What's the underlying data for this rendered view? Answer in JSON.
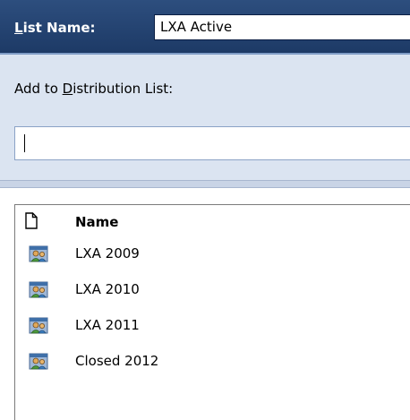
{
  "header": {
    "list_name_label_first": "L",
    "list_name_label_rest": "ist Name:",
    "list_name_value": "LXA Active"
  },
  "distribution": {
    "label_before": "Add to ",
    "label_underlined": "D",
    "label_after": "istribution List:",
    "input_value": ""
  },
  "list": {
    "name_column_header": "Name",
    "items": [
      {
        "label": "LXA 2009",
        "icon": "contact-group-icon"
      },
      {
        "label": "LXA 2010",
        "icon": "contact-group-icon"
      },
      {
        "label": "LXA 2011",
        "icon": "contact-group-icon"
      },
      {
        "label": "Closed 2012",
        "icon": "contact-group-icon"
      }
    ]
  },
  "colors": {
    "header_bg": "#2d4e7e",
    "panel_bg": "#dbe4f1"
  }
}
